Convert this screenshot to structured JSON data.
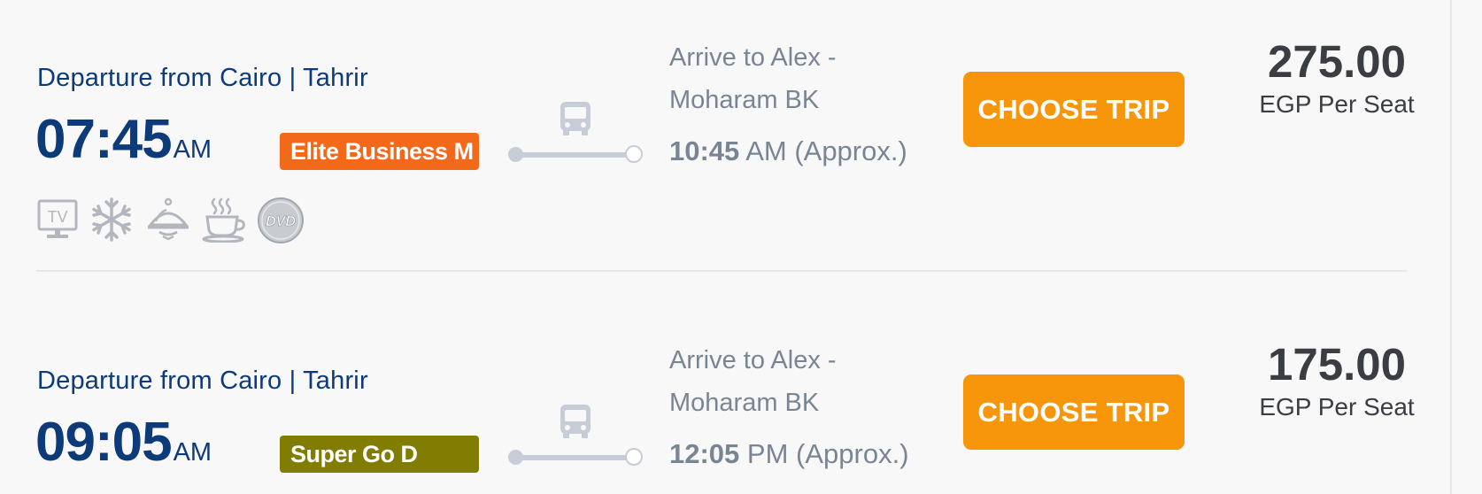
{
  "trips": [
    {
      "departure_label": "Departure from Cairo | Tahrir",
      "departure_time": "07:45",
      "departure_ampm": "AM",
      "bus_class": "Elite Business M",
      "bus_class_color": "#f2691a",
      "arrival_label": "Arrive to Alex - Moharam BK",
      "arrival_time": "10:45",
      "arrival_suffix": "AM (Approx.)",
      "button_label": "CHOOSE TRIP",
      "price": "275.00",
      "price_unit": "EGP Per Seat",
      "amenities": [
        "tv-icon",
        "air-conditioning-icon",
        "meal-service-icon",
        "hot-drink-icon",
        "dvd-icon"
      ],
      "amenity_labels": {
        "tv": "TV",
        "dvd": "DVD"
      }
    },
    {
      "departure_label": "Departure from Cairo | Tahrir",
      "departure_time": "09:05",
      "departure_ampm": "AM",
      "bus_class": "Super Go D",
      "bus_class_color": "#817c02",
      "arrival_label": "Arrive to Alex - Moharam BK",
      "arrival_time": "12:05",
      "arrival_suffix": "PM (Approx.)",
      "button_label": "CHOOSE TRIP",
      "price": "175.00",
      "price_unit": "EGP Per Seat"
    }
  ],
  "colors": {
    "primary_text": "#0d3a78",
    "accent_button": "#f7960b",
    "muted_text": "#7a8593",
    "price_text": "#3a3d42"
  }
}
